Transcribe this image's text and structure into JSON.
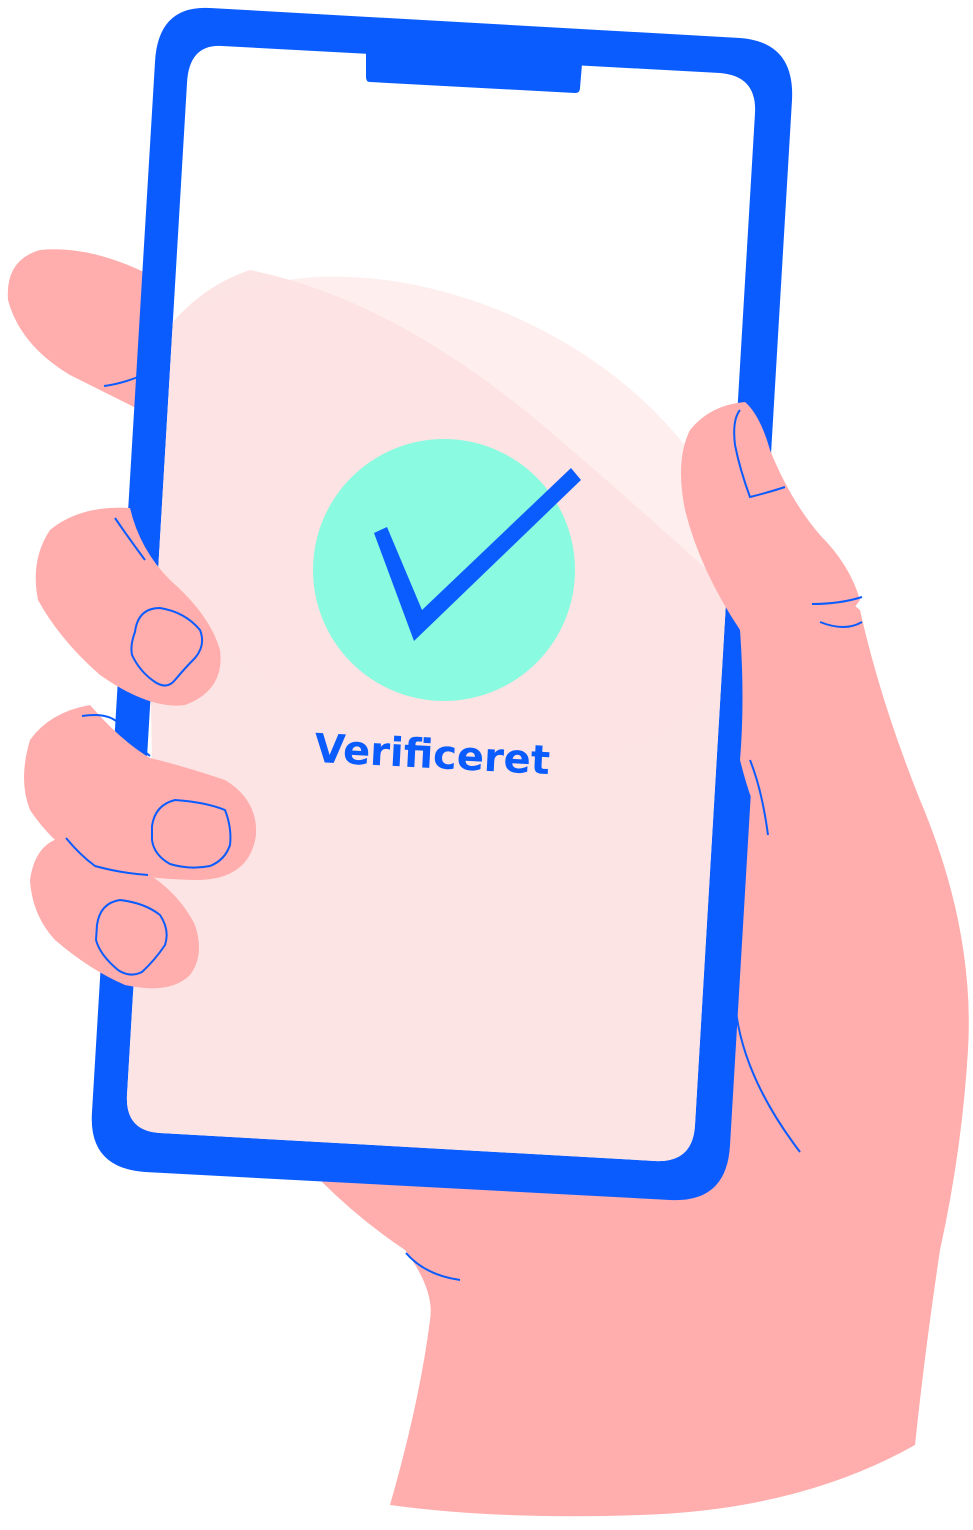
{
  "screen": {
    "status_text": "Verificeret",
    "status_icon": "checkmark-icon"
  },
  "colors": {
    "phone_frame": "#0a5cff",
    "skin": "#ffadad",
    "skin_line": "#0a5cff",
    "screen_bg": "#ffffff",
    "screen_glow": "#fde3e3",
    "check_circle": "#8afbe0",
    "check_mark": "#0a5cff",
    "status_text": "#0a5cff"
  }
}
